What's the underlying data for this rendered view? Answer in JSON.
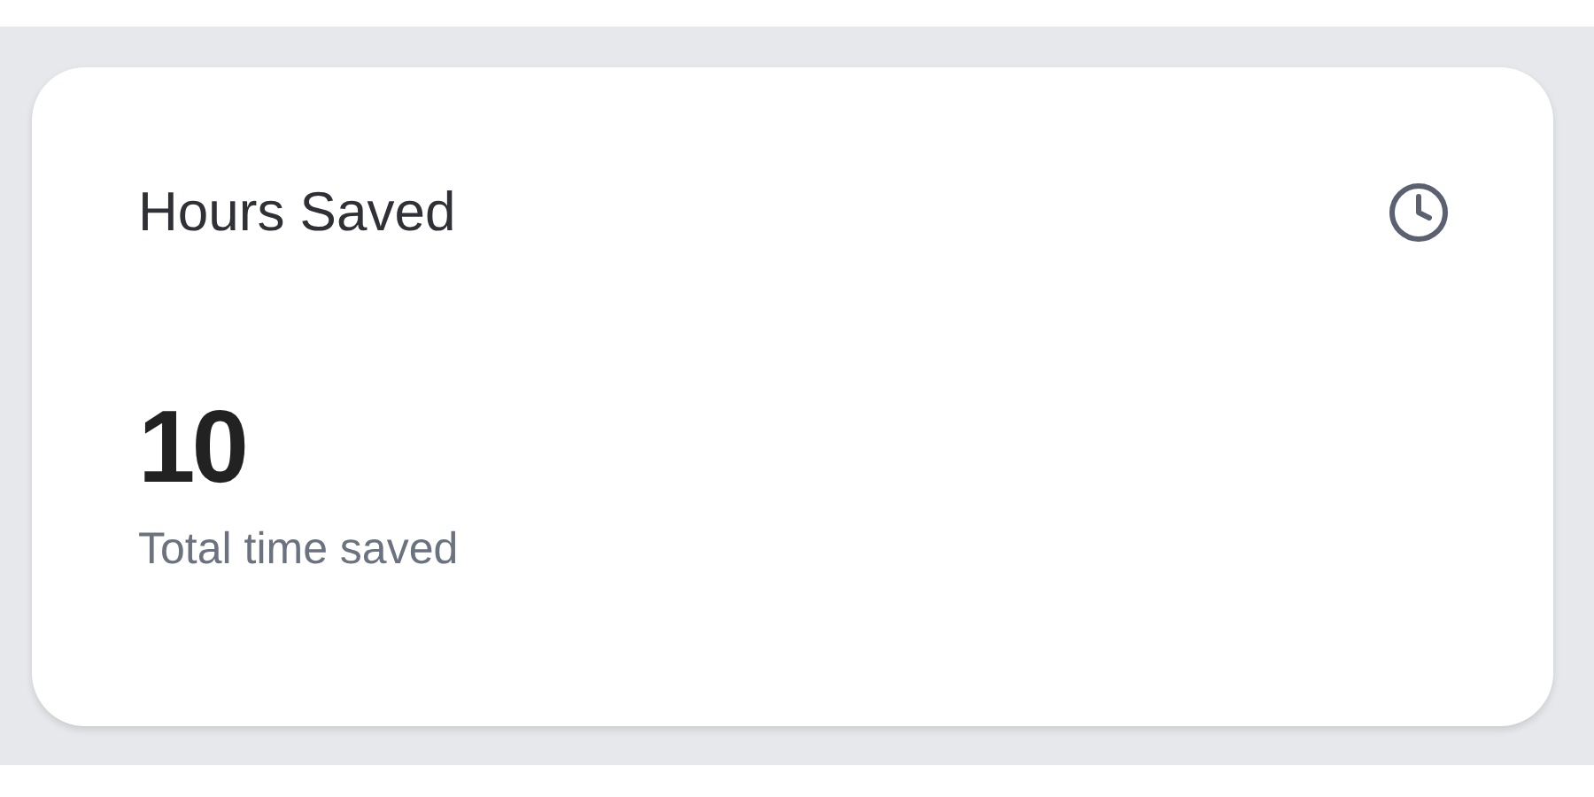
{
  "card": {
    "title": "Hours Saved",
    "value": "10",
    "caption": "Total time saved"
  }
}
